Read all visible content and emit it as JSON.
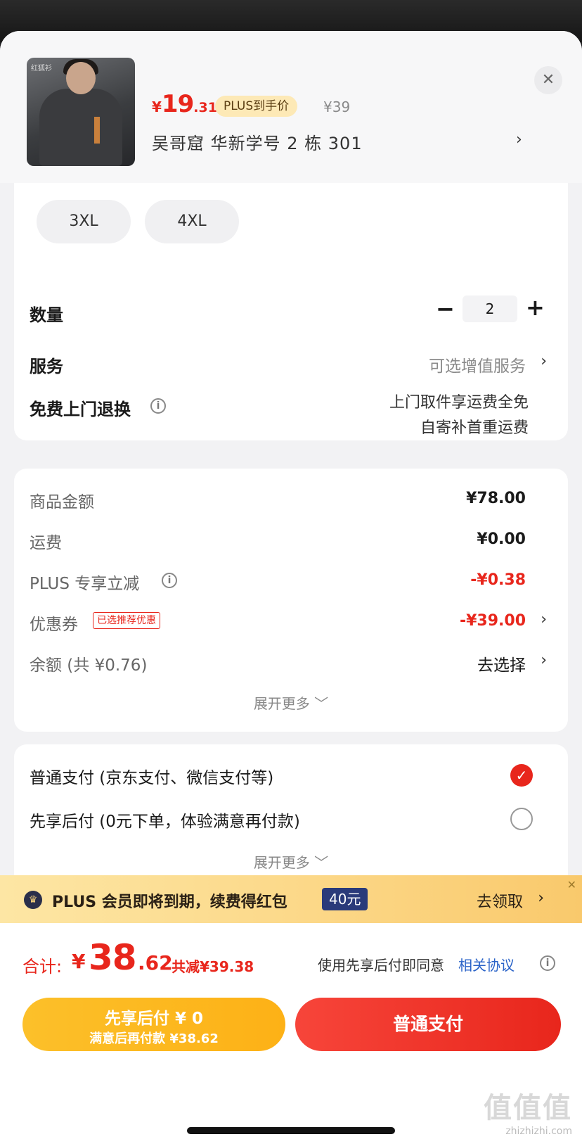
{
  "product": {
    "price_symbol": "¥",
    "price_int": "19",
    "price_dec": ".31",
    "plus_badge": "PLUS到手价",
    "original_price": "¥39",
    "address": "吴哥窟  华新学号 2 栋 301",
    "thumb_brand": "红狐衫"
  },
  "sizes": {
    "items": [
      "3XL",
      "4XL"
    ]
  },
  "quantity": {
    "label": "数量",
    "value": "2",
    "minus": "−",
    "plus": "+"
  },
  "service": {
    "label": "服务",
    "value": "可选增值服务"
  },
  "return_service": {
    "label": "免费上门退换",
    "line1": "上门取件享运费全免",
    "line2": "自寄补首重运费"
  },
  "summary": {
    "goods_label": "商品金额",
    "goods_value": "¥78.00",
    "shipping_label": "运费",
    "shipping_value": "¥0.00",
    "plus_label": "PLUS 专享立减",
    "plus_value": "-¥0.38",
    "coupon_label": "优惠券",
    "coupon_tag": "已选推荐优惠",
    "coupon_value": "-¥39.00",
    "balance_label": "余额 (共 ¥0.76)",
    "balance_value": "去选择",
    "expand": "展开更多 ﹀"
  },
  "payment": {
    "normal": "普通支付 (京东支付、微信支付等)",
    "bnpl": "先享后付 (0元下单，体验满意再付款)",
    "expand": "展开更多 ﹀"
  },
  "plus_banner": {
    "text": "PLUS 会员即将到期，续费得红包",
    "amount": "40元",
    "claim": "去领取"
  },
  "bottom": {
    "total_label": "合计:",
    "total_symbol": "¥",
    "total_int": "38",
    "total_dec": ".62",
    "total_saved": "共减¥39.38",
    "agree_text": "使用先享后付即同意",
    "agree_link": "相关协议",
    "bnpl_line1": "先享后付 ¥ 0",
    "bnpl_line2": "满意后再付款 ¥38.62",
    "pay_button": "普通支付"
  },
  "watermark": {
    "big": "值值值",
    "small": "zhizhizhi.com"
  },
  "colors": {
    "accent_red": "#e8261c",
    "bnpl_yellow": "#fdb116",
    "link_blue": "#2a63c8"
  }
}
